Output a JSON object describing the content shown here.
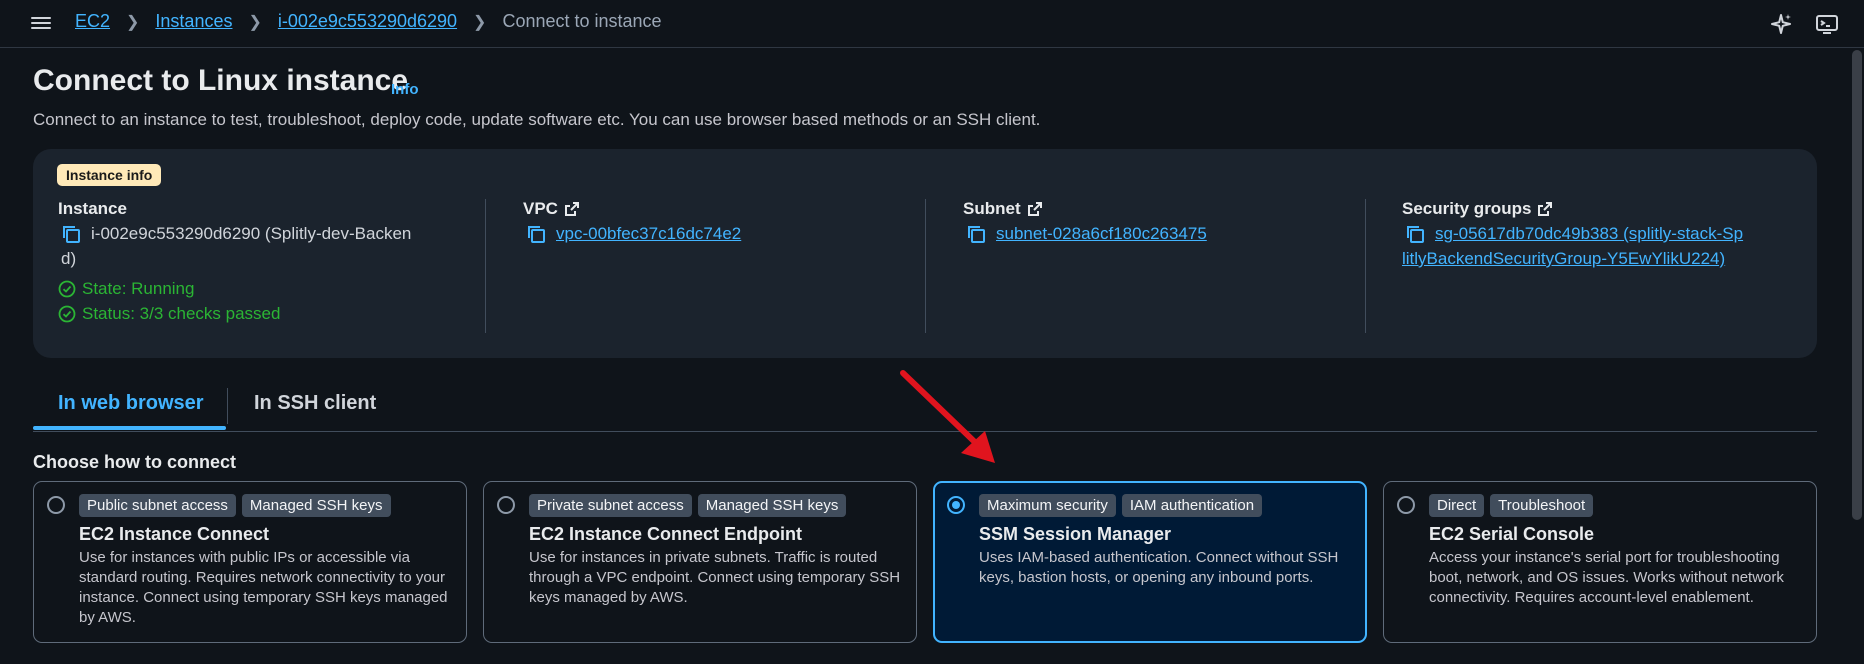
{
  "breadcrumb": {
    "items": [
      "EC2",
      "Instances",
      "i-002e9c553290d6290"
    ],
    "current": "Connect to instance"
  },
  "page": {
    "title": "Connect to Linux instance",
    "info_link": "Info",
    "description": "Connect to an instance to test, troubleshoot, deploy code, update software etc. You can use browser based methods or an SSH client."
  },
  "instance_card": {
    "badge": "Instance info",
    "instance": {
      "label": "Instance",
      "value_line1": "i-002e9c553290d6290 (Splitly-dev-Backen",
      "value_line2": "d)",
      "state": "State: Running",
      "status": "Status: 3/3 checks passed"
    },
    "vpc": {
      "label": "VPC",
      "value": "vpc-00bfec37c16dc74e2"
    },
    "subnet": {
      "label": "Subnet",
      "value": "subnet-028a6cf180c263475"
    },
    "security_groups": {
      "label": "Security groups",
      "value_line1": "sg-05617db70dc49b383 (splitly-stack-Sp",
      "value_line2": "litlyBackendSecurityGroup-Y5EwYlikU224)"
    }
  },
  "tabs": [
    {
      "label": "In web browser",
      "active": true
    },
    {
      "label": "In SSH client",
      "active": false
    }
  ],
  "choose_label": "Choose how to connect",
  "options": [
    {
      "tags": [
        "Public subnet access",
        "Managed SSH keys"
      ],
      "title": "EC2 Instance Connect",
      "desc": "Use for instances with public IPs or accessible via standard routing. Requires network connectivity to your instance. Connect using temporary SSH keys managed by AWS.",
      "selected": false
    },
    {
      "tags": [
        "Private subnet access",
        "Managed SSH keys"
      ],
      "title": "EC2 Instance Connect Endpoint",
      "desc": "Use for instances in private subnets. Traffic is routed through a VPC endpoint. Connect using temporary SSH keys managed by AWS.",
      "selected": false
    },
    {
      "tags": [
        "Maximum security",
        "IAM authentication"
      ],
      "title": "SSM Session Manager",
      "desc": "Uses IAM-based authentication. Connect without SSH keys, bastion hosts, or opening any inbound ports.",
      "selected": true
    },
    {
      "tags": [
        "Direct",
        "Troubleshoot"
      ],
      "title": "EC2 Serial Console",
      "desc": "Access your instance's serial port for troubleshooting boot, network, and OS issues. Works without network connectivity. Requires account-level enablement.",
      "selected": false
    }
  ],
  "colors": {
    "background": "#0f141a",
    "link": "#42b4ff",
    "success": "#2bb534",
    "badge": "#ffe9b8",
    "arrow": "#e0141e"
  },
  "icons": {
    "menu": "hamburger-icon",
    "ai": "sparkle-icon",
    "shell": "cloudshell-icon",
    "external": "external-link-icon",
    "copy": "copy-icon",
    "check": "check-circle-icon"
  }
}
